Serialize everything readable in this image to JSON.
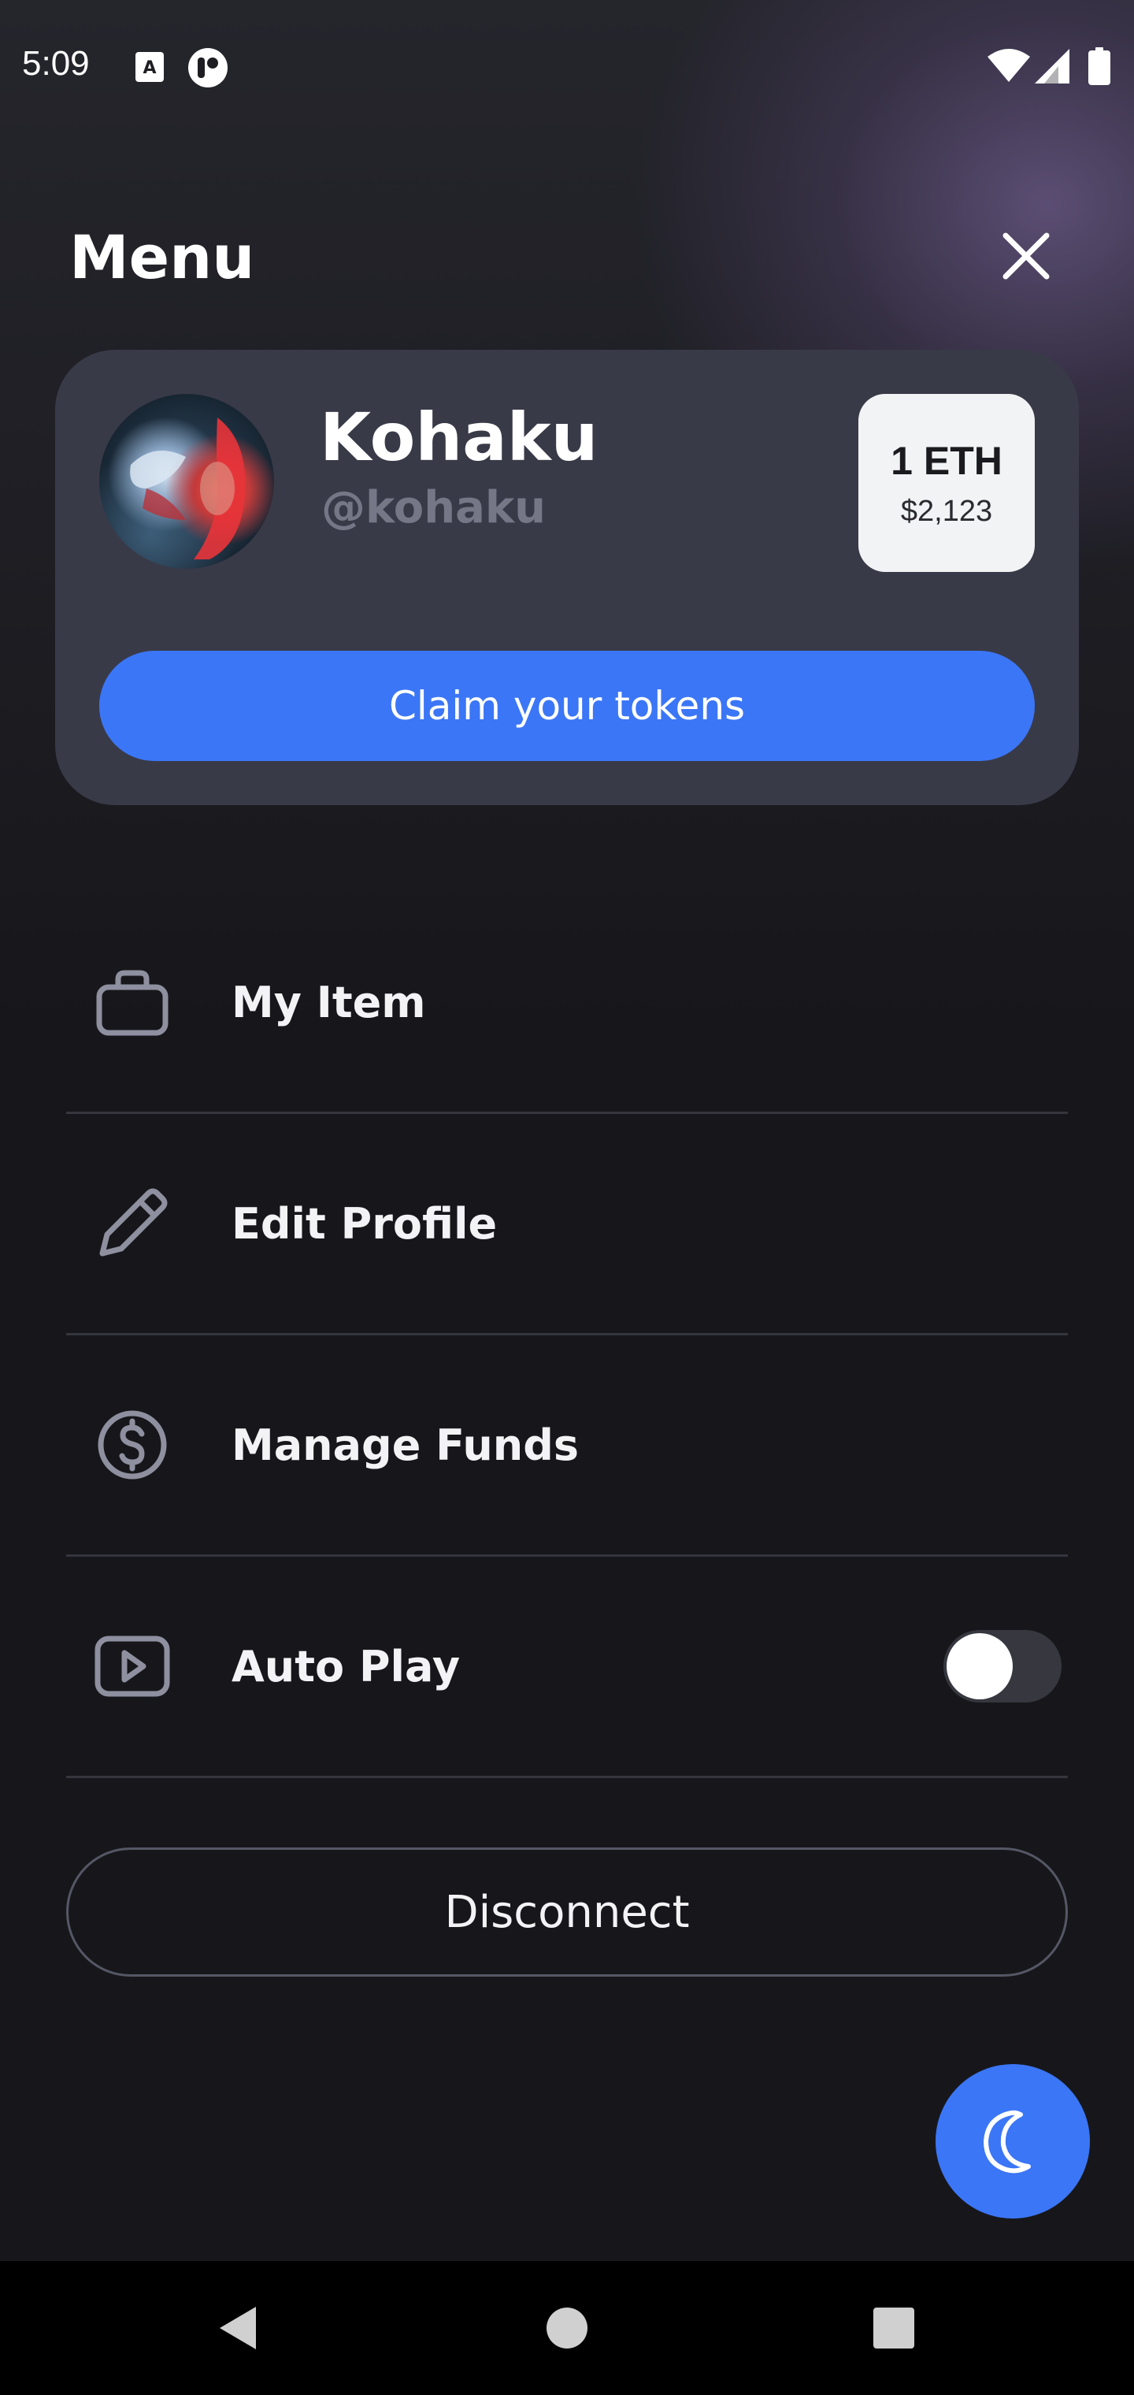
{
  "status_bar": {
    "time": "5:09",
    "icons": [
      "notification-a-icon",
      "app-notification-icon",
      "wifi-icon",
      "signal-icon",
      "battery-icon"
    ]
  },
  "header": {
    "title": "Menu",
    "close_icon": "close-icon"
  },
  "profile": {
    "name": "Kohaku",
    "handle": "@kohaku",
    "balance": {
      "amount": "1 ETH",
      "usd": "$2,123"
    },
    "claim_label": "Claim your tokens"
  },
  "menu": {
    "items": [
      {
        "label": "My Item",
        "icon": "briefcase-icon"
      },
      {
        "label": "Edit Profile",
        "icon": "pencil-icon"
      },
      {
        "label": "Manage Funds",
        "icon": "dollar-circle-icon"
      },
      {
        "label": "Auto Play",
        "icon": "play-icon",
        "toggle": false
      }
    ]
  },
  "disconnect_label": "Disconnect",
  "theme_fab_icon": "moon-icon",
  "nav": {
    "icons": [
      "back-icon",
      "home-icon",
      "recents-icon"
    ]
  },
  "colors": {
    "accent": "#3b76f6",
    "card": "#393a48",
    "background": "#17171b"
  }
}
